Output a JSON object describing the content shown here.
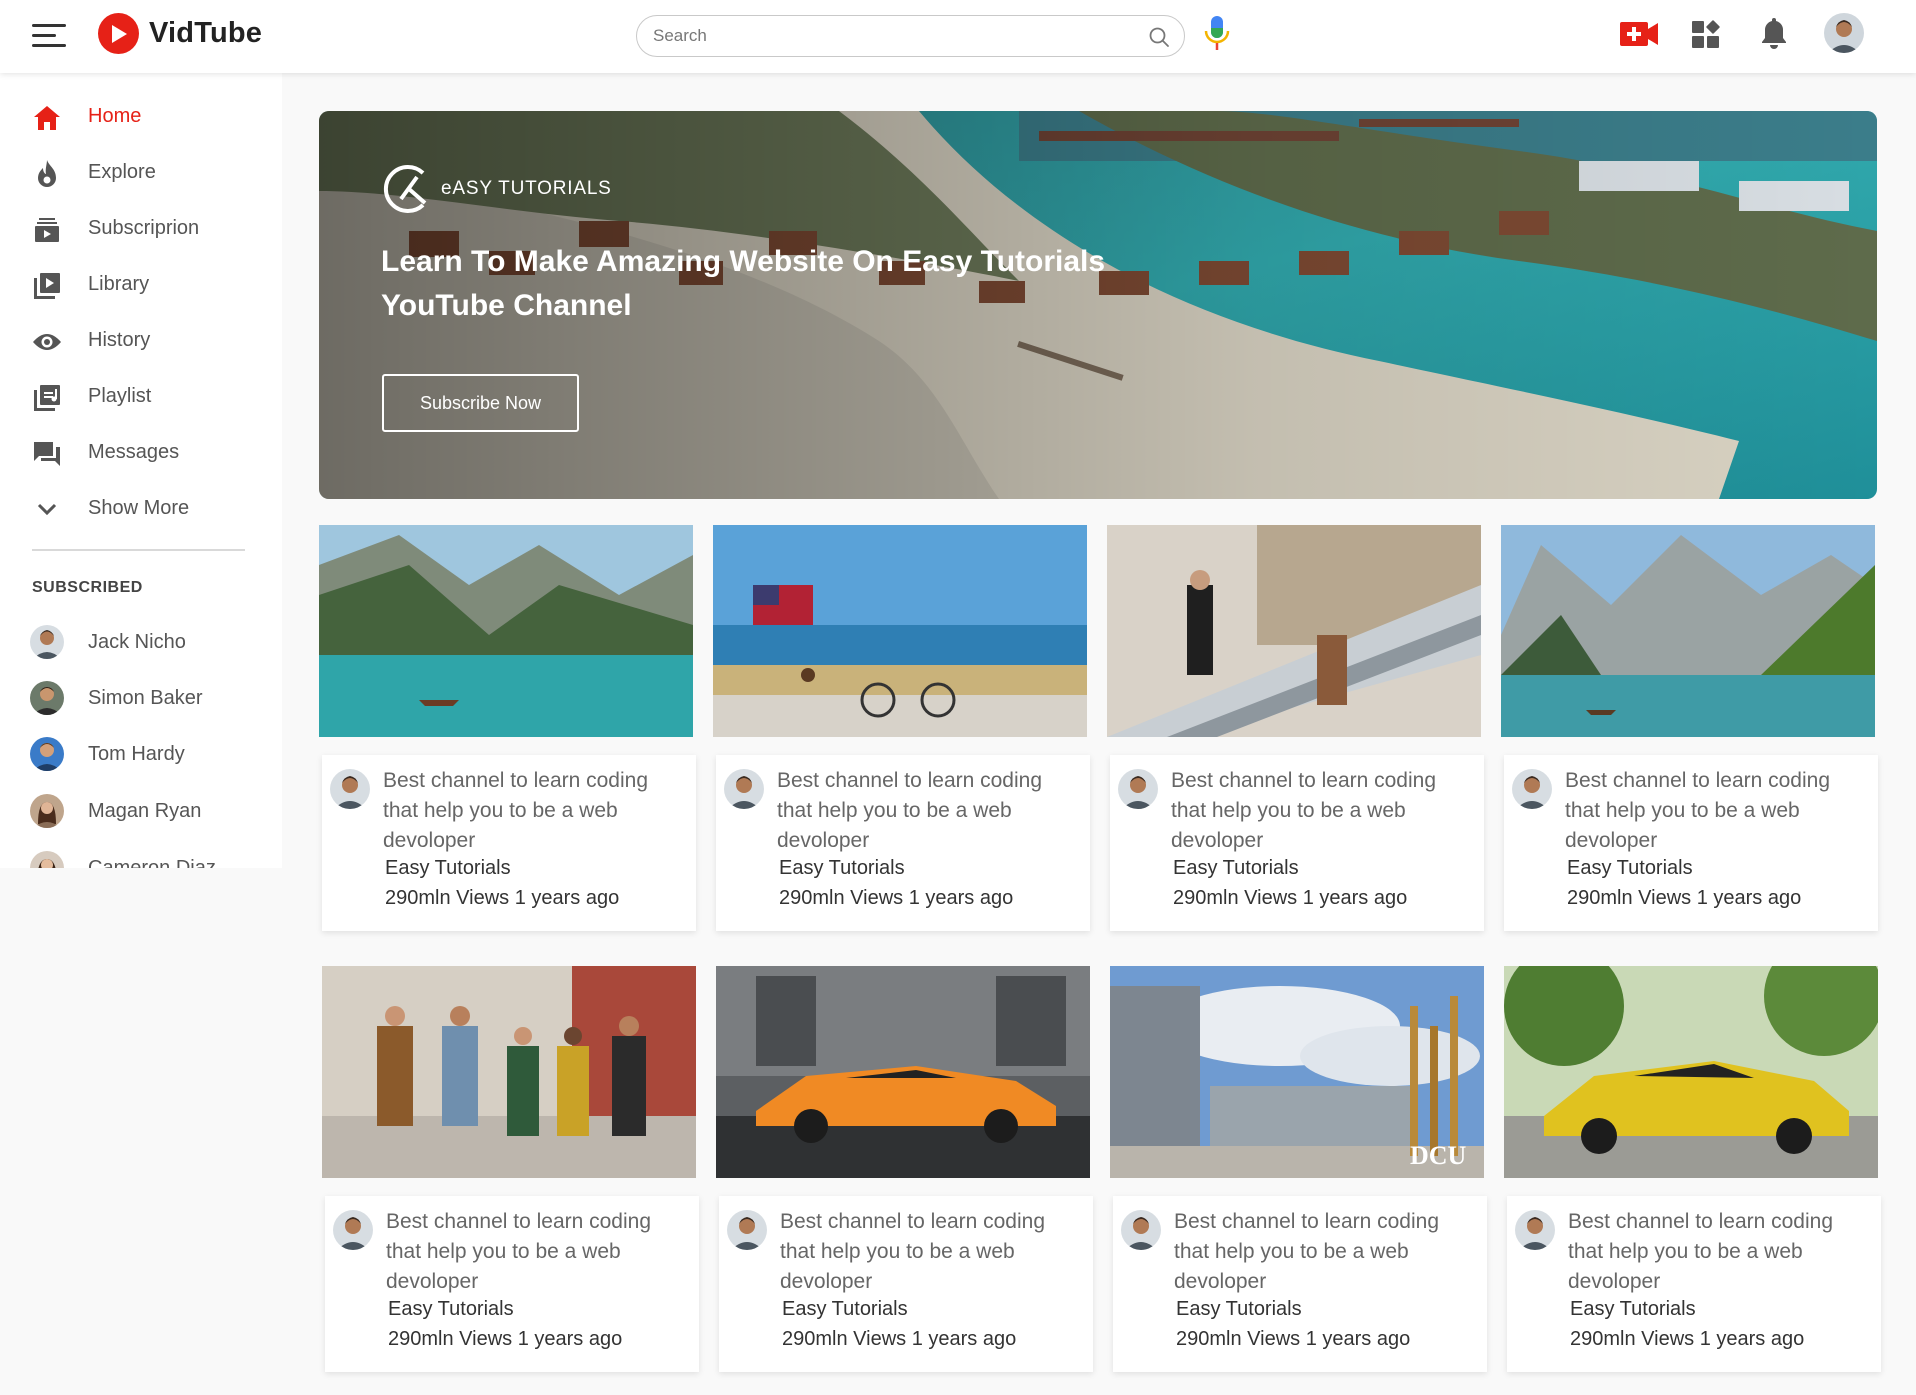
{
  "app": {
    "name": "VidTube",
    "brand_color": "#e62117"
  },
  "search": {
    "placeholder": "Search",
    "value": ""
  },
  "header_icons": [
    "hamburger-menu-icon",
    "search-icon",
    "microphone-icon",
    "upload-video-icon",
    "apps-grid-icon",
    "notifications-bell-icon",
    "user-avatar"
  ],
  "sidebar": {
    "nav": [
      {
        "label": "Home",
        "icon": "home-icon",
        "active": true
      },
      {
        "label": "Explore",
        "icon": "flame-icon"
      },
      {
        "label": "Subscriprion",
        "icon": "subscriptions-icon"
      },
      {
        "label": "Library",
        "icon": "library-icon"
      },
      {
        "label": "History",
        "icon": "history-eye-icon"
      },
      {
        "label": "Playlist",
        "icon": "playlist-icon"
      },
      {
        "label": "Messages",
        "icon": "messages-icon"
      },
      {
        "label": "Show More",
        "icon": "chevron-down-icon"
      }
    ],
    "subscribed_heading": "SUBSCRIBED",
    "subscribed": [
      {
        "name": "Jack Nicho"
      },
      {
        "name": "Simon Baker"
      },
      {
        "name": "Tom Hardy"
      },
      {
        "name": "Magan Ryan"
      },
      {
        "name": "Cameron Diaz"
      }
    ]
  },
  "banner": {
    "logo_text": "eASY TUTORIALS",
    "title": "Learn To Make Amazing Website On Easy Tutorials YouTube Channel",
    "button": "Subscribe Now"
  },
  "videos": [
    {
      "thumbnail": "lake-mountains-boat",
      "title": "Best channel to learn coding that help you to be a web devoloper",
      "channel": "Easy Tutorials",
      "meta": "290mln Views 1 years ago"
    },
    {
      "thumbnail": "beach-flag-bicycle",
      "title": "Best channel to learn coding that help you to be a web devoloper",
      "channel": "Easy Tutorials",
      "meta": "290mln Views 1 years ago"
    },
    {
      "thumbnail": "mall-escalator",
      "title": "Best channel to learn coding that help you to be a web devoloper",
      "channel": "Easy Tutorials",
      "meta": "290mln Views 1 years ago"
    },
    {
      "thumbnail": "alpine-lake-mountains",
      "title": "Best channel to learn coding that help you to be a web devoloper",
      "channel": "Easy Tutorials",
      "meta": "290mln Views 1 years ago"
    },
    {
      "thumbnail": "friends-walking-street",
      "title": "Best channel to learn coding that help you to be a web devoloper",
      "channel": "Easy Tutorials",
      "meta": "290mln Views 1 years ago"
    },
    {
      "thumbnail": "orange-sports-car",
      "title": "Best channel to learn coding that help you to be a web devoloper",
      "channel": "Easy Tutorials",
      "meta": "290mln Views 1 years ago"
    },
    {
      "thumbnail": "dcu-campus-building",
      "thumbnail_label": "DCU",
      "title": "Best channel to learn coding that help you to be a web devoloper",
      "channel": "Easy Tutorials",
      "meta": "290mln Views 1 years ago"
    },
    {
      "thumbnail": "yellow-sports-car",
      "title": "Best channel to learn coding that help you to be a web devoloper",
      "channel": "Easy Tutorials",
      "meta": "290mln Views 1 years ago"
    }
  ]
}
